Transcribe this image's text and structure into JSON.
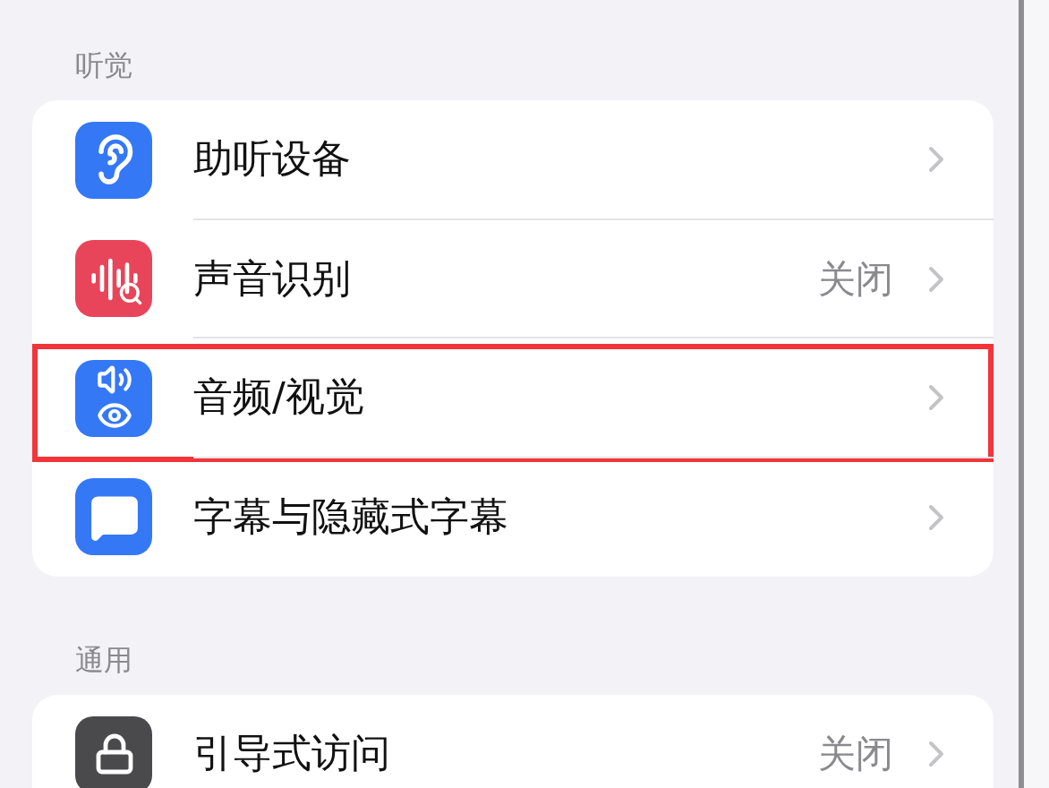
{
  "sections": [
    {
      "header": "听觉",
      "items": [
        {
          "label": "助听设备",
          "color": "#3478f6",
          "highlighted": false
        },
        {
          "label": "声音识别",
          "value": "关闭",
          "color": "#e8455a",
          "highlighted": false
        },
        {
          "label": "音频/视觉",
          "color": "#3478f6",
          "highlighted": true
        },
        {
          "label": "字幕与隐藏式字幕",
          "color": "#3478f6",
          "highlighted": false
        }
      ]
    },
    {
      "header": "通用",
      "items": [
        {
          "label": "引导式访问",
          "value": "关闭",
          "color": "#4a4a4c",
          "highlighted": false
        }
      ]
    }
  ]
}
